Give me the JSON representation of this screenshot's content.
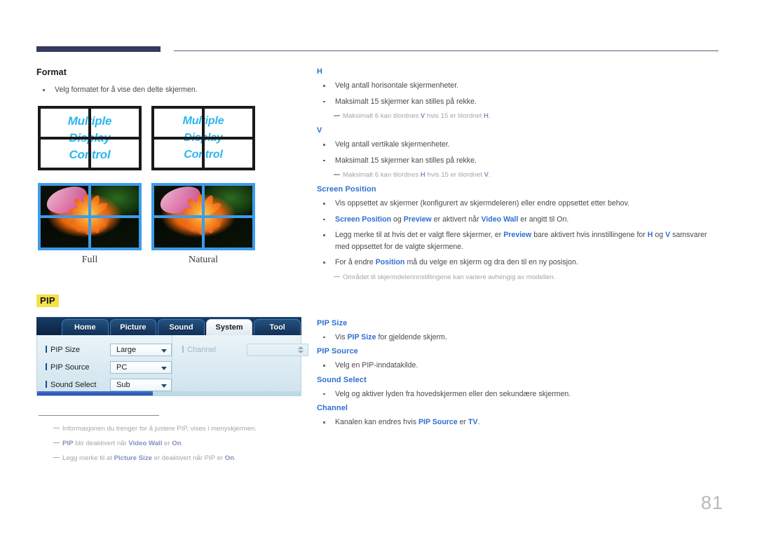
{
  "page": {
    "number": "81"
  },
  "left": {
    "format": {
      "heading": "Format",
      "bullets": [
        "Velg formatet for å vise den delte skjermen."
      ],
      "diagrams": {
        "wall_text_line1": "Multiple",
        "wall_text_line2": "Display",
        "wall_text_line3": "Control",
        "caption_full": "Full",
        "caption_natural": "Natural"
      }
    },
    "pip": {
      "label": "PIP",
      "osd": {
        "tabs": [
          {
            "label": "Home",
            "active": false
          },
          {
            "label": "Picture",
            "active": false
          },
          {
            "label": "Sound",
            "active": false
          },
          {
            "label": "System",
            "active": true
          },
          {
            "label": "Tool",
            "active": false
          }
        ],
        "rows_left": [
          {
            "name": "PIP Size",
            "value": "Large"
          },
          {
            "name": "PIP Source",
            "value": "PC"
          },
          {
            "name": "Sound Select",
            "value": "Sub"
          }
        ],
        "rows_right": [
          {
            "name": "Channel",
            "value": ""
          }
        ]
      },
      "notes": [
        {
          "parts": [
            {
              "t": "Informasjonen du trenger for å justere PIP, vises i menyskjermen.",
              "s": "plain"
            }
          ]
        },
        {
          "parts": [
            {
              "t": "PIP",
              "s": "bold"
            },
            {
              "t": " blir deaktivert når ",
              "s": "plain"
            },
            {
              "t": "Video Wall",
              "s": "bold"
            },
            {
              "t": " er ",
              "s": "plain"
            },
            {
              "t": "On",
              "s": "bold"
            },
            {
              "t": ".",
              "s": "plain"
            }
          ]
        },
        {
          "parts": [
            {
              "t": "Legg merke til at ",
              "s": "plain"
            },
            {
              "t": "Picture Size",
              "s": "bold"
            },
            {
              "t": " er deaktivert når PIP er ",
              "s": "plain"
            },
            {
              "t": "On",
              "s": "bold"
            },
            {
              "t": ".",
              "s": "plain"
            }
          ]
        }
      ]
    }
  },
  "right": {
    "h": {
      "heading": "H",
      "bullets": [
        "Velg antall horisontale skjermenheter.",
        "Maksimalt 15 skjermer kan stilles på rekke."
      ],
      "note": [
        {
          "t": "Maksimalt 6 kan tilordnes ",
          "s": "plain"
        },
        {
          "t": "V",
          "s": "bold"
        },
        {
          "t": " hvis 15 er tilordnet ",
          "s": "plain"
        },
        {
          "t": "H",
          "s": "bold"
        },
        {
          "t": ".",
          "s": "plain"
        }
      ]
    },
    "v": {
      "heading": "V",
      "bullets": [
        "Velg antall vertikale skjermenheter.",
        "Maksimalt 15 skjermer kan stilles på rekke."
      ],
      "note": [
        {
          "t": "Maksimalt 6 kan tilordnes ",
          "s": "plain"
        },
        {
          "t": "H",
          "s": "bold"
        },
        {
          "t": " hvis 15 er tilordnet ",
          "s": "plain"
        },
        {
          "t": "V",
          "s": "bold"
        },
        {
          "t": ".",
          "s": "plain"
        }
      ]
    },
    "screen_position": {
      "heading": "Screen Position",
      "bullets": [
        [
          {
            "t": "Vis oppsettet av skjermer (konfigurert av skjermdeleren) eller endre oppsettet etter behov.",
            "s": "plain"
          }
        ],
        [
          {
            "t": "Screen Position",
            "s": "blue"
          },
          {
            "t": " og ",
            "s": "plain"
          },
          {
            "t": "Preview",
            "s": "blue"
          },
          {
            "t": " er aktivert når ",
            "s": "plain"
          },
          {
            "t": "Video Wall",
            "s": "blue"
          },
          {
            "t": " er angitt til On.",
            "s": "plain"
          }
        ],
        [
          {
            "t": "Legg merke til at hvis det er valgt flere skjermer, er ",
            "s": "plain"
          },
          {
            "t": "Preview",
            "s": "blue"
          },
          {
            "t": " bare aktivert hvis innstillingene for ",
            "s": "plain"
          },
          {
            "t": "H",
            "s": "blue"
          },
          {
            "t": " og ",
            "s": "plain"
          },
          {
            "t": "V",
            "s": "blue"
          },
          {
            "t": " samsvarer med oppsettet for de valgte skjermene.",
            "s": "plain"
          }
        ],
        [
          {
            "t": "For å endre ",
            "s": "plain"
          },
          {
            "t": "Position",
            "s": "blue"
          },
          {
            "t": " må du velge en skjerm og dra den til en ny posisjon.",
            "s": "plain"
          }
        ]
      ],
      "note": [
        {
          "t": "Området til skjermdelerinnstillingene kan variere avhengig av modellen.",
          "s": "plain"
        }
      ]
    },
    "pip_size": {
      "heading": "PIP Size",
      "bullets": [
        [
          {
            "t": "Vis ",
            "s": "plain"
          },
          {
            "t": "PIP Size",
            "s": "blue"
          },
          {
            "t": " for gjeldende skjerm.",
            "s": "plain"
          }
        ]
      ]
    },
    "pip_source": {
      "heading": "PIP Source",
      "bullets": [
        [
          {
            "t": "Velg en PIP-inndatakilde.",
            "s": "plain"
          }
        ]
      ]
    },
    "sound_select": {
      "heading": "Sound Select",
      "bullets": [
        [
          {
            "t": "Velg og aktiver lyden fra hovedskjermen eller den sekundære skjermen.",
            "s": "plain"
          }
        ]
      ]
    },
    "channel": {
      "heading": "Channel",
      "bullets": [
        [
          {
            "t": "Kanalen kan endres hvis ",
            "s": "plain"
          },
          {
            "t": "PIP Source",
            "s": "blue"
          },
          {
            "t": " er ",
            "s": "plain"
          },
          {
            "t": "TV",
            "s": "blue"
          },
          {
            "t": ".",
            "s": "plain"
          }
        ]
      ]
    }
  },
  "colors": {
    "accent_blue": "#2f6fd0",
    "header_bar": "#353b5e",
    "highlight_yellow": "#f5e04a",
    "panel_border_blue": "#3d9bea",
    "wall_text": "#2cb6ef"
  }
}
